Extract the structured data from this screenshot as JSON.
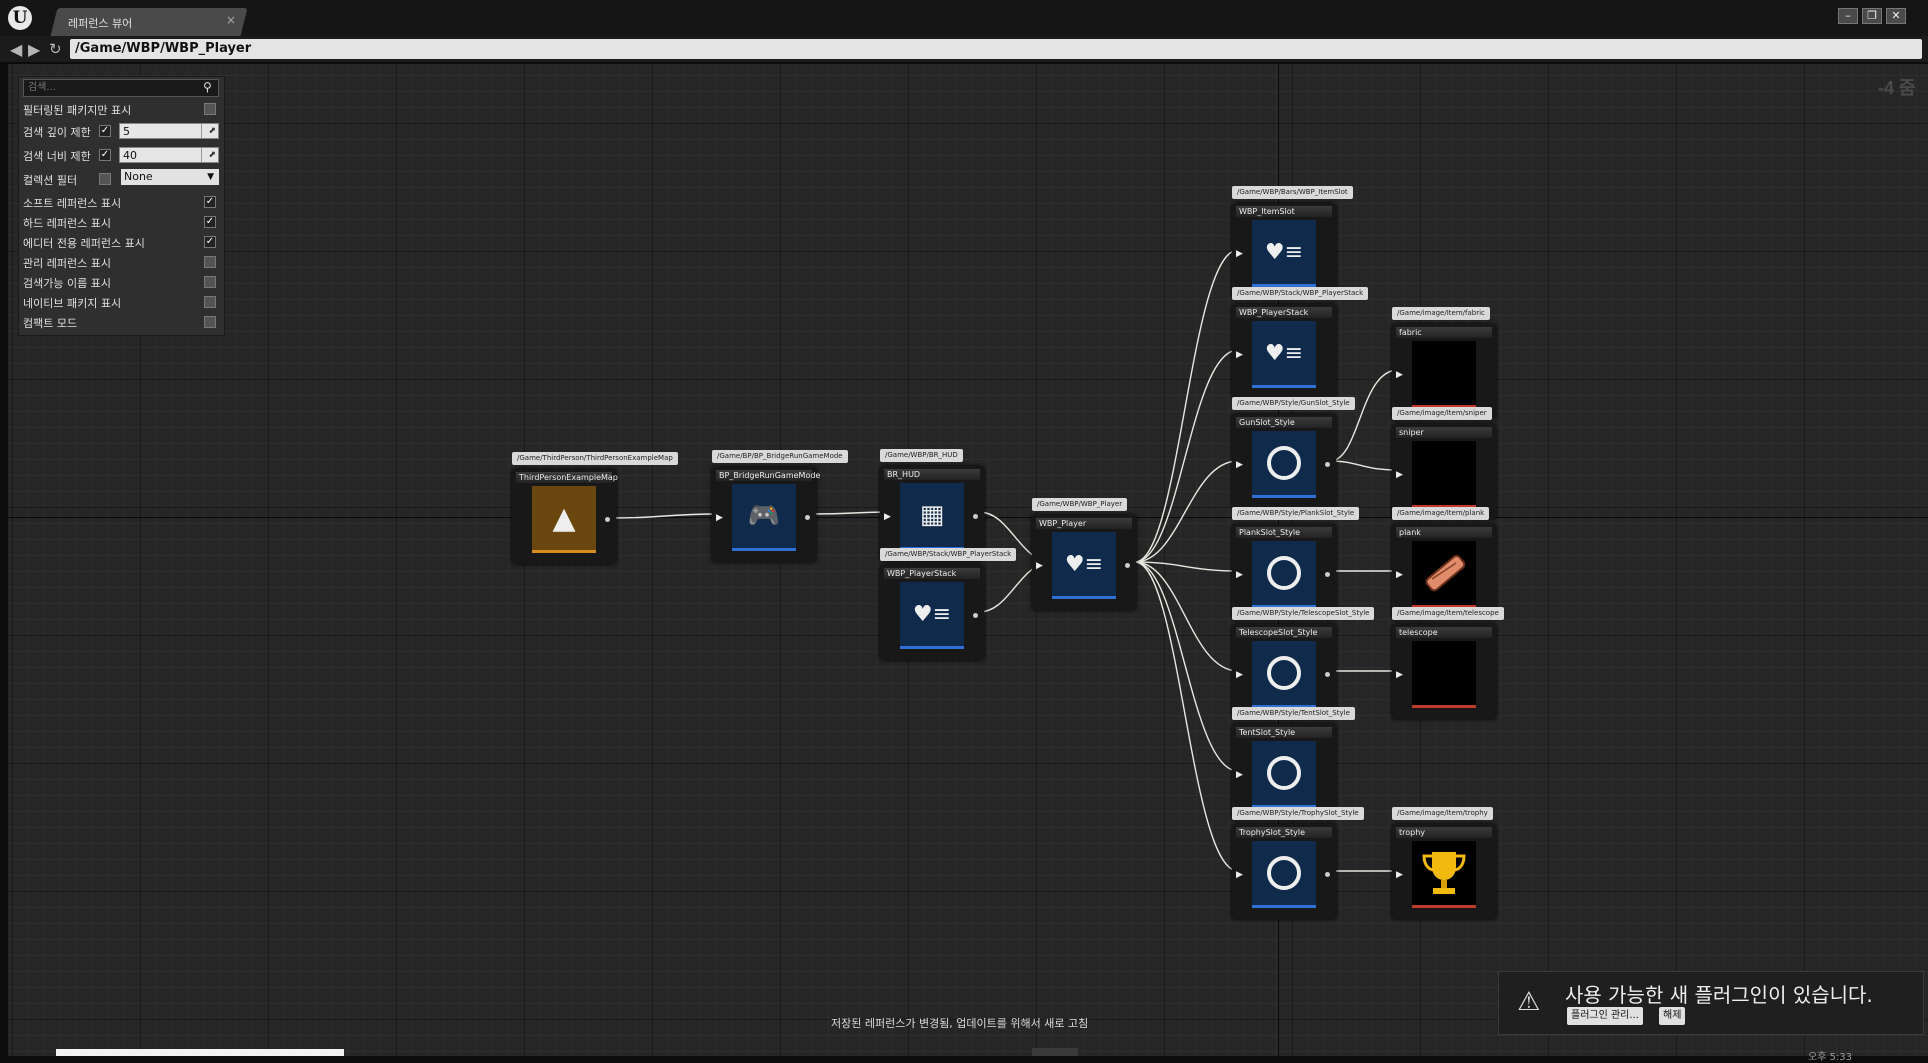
{
  "window": {
    "tab_label": "레퍼런스 뷰어",
    "tab_close": "×",
    "logo": "U",
    "controls": [
      "–",
      "❐",
      "✕"
    ]
  },
  "pathbar": {
    "back_icon": "arrow-left-icon",
    "forward_icon": "arrow-right-icon",
    "refresh_icon": "refresh-icon",
    "path": "/Game/WBP/WBP_Player"
  },
  "zoom": "-4 줌",
  "settings": {
    "search_placeholder": "검색...",
    "filtered_only": {
      "label": "필터링된 패키지만 표시",
      "checked": false
    },
    "depth_limit": {
      "label": "검색 깊이 제한",
      "checked": true,
      "value": "5"
    },
    "breadth_limit": {
      "label": "검색 너비 제한",
      "checked": true,
      "value": "40"
    },
    "collection_filter": {
      "label": "컬렉션 필터",
      "checked": false,
      "value": "None"
    },
    "options": [
      {
        "label": "소프트 레퍼런스 표시",
        "checked": true
      },
      {
        "label": "하드 레퍼런스 표시",
        "checked": true
      },
      {
        "label": "에디터 전용 레퍼런스 표시",
        "checked": true
      },
      {
        "label": "관리 레퍼런스 표시",
        "checked": false
      },
      {
        "label": "검색가능 이름 표시",
        "checked": false
      },
      {
        "label": "네이티브 패키지 표시",
        "checked": false
      },
      {
        "label": "컴팩트 모드",
        "checked": false
      }
    ]
  },
  "nodes": [
    {
      "path": "/Game/ThirdPerson/ThirdPersonExampleMap",
      "name": "ThirdPersonExampleMap",
      "icon": "map-icon",
      "color": "orange"
    },
    {
      "path": "/Game/BP/BP_BridgeRunGameMode",
      "name": "BP_BridgeRunGameMode",
      "icon": "gamepad-icon",
      "color": "blue"
    },
    {
      "path": "/Game/WBP/BR_HUD",
      "name": "BR_HUD",
      "icon": "hud-icon",
      "color": "blue"
    },
    {
      "path": "/Game/WBP/Stack/WBP_PlayerStack",
      "name": "WBP_PlayerStack",
      "icon": "widget-icon",
      "color": "blue"
    },
    {
      "path": "/Game/WBP/WBP_Player",
      "name": "WBP_Player",
      "icon": "widget-icon",
      "color": "blue"
    },
    {
      "path": "/Game/WBP/Bars/WBP_ItemSlot",
      "name": "WBP_ItemSlot",
      "icon": "widget-icon",
      "color": "blue"
    },
    {
      "path": "/Game/WBP/Stack/WBP_PlayerStack",
      "name": "WBP_PlayerStack",
      "icon": "widget-icon",
      "color": "blue"
    },
    {
      "path": "/Game/WBP/Style/GunSlot_Style",
      "name": "GunSlot_Style",
      "icon": "ring-icon",
      "color": "blue"
    },
    {
      "path": "/Game/WBP/Style/PlankSlot_Style",
      "name": "PlankSlot_Style",
      "icon": "ring-icon",
      "color": "blue"
    },
    {
      "path": "/Game/WBP/Style/TelescopeSlot_Style",
      "name": "TelescopeSlot_Style",
      "icon": "ring-icon",
      "color": "blue"
    },
    {
      "path": "/Game/WBP/Style/TentSlot_Style",
      "name": "TentSlot_Style",
      "icon": "ring-icon",
      "color": "blue"
    },
    {
      "path": "/Game/WBP/Style/TrophySlot_Style",
      "name": "TrophySlot_Style",
      "icon": "ring-icon",
      "color": "blue"
    },
    {
      "path": "/Game/image/Item/fabric",
      "name": "fabric",
      "icon": "texture-icon",
      "color": "black"
    },
    {
      "path": "/Game/image/Item/sniper",
      "name": "sniper",
      "icon": "texture-icon",
      "color": "black"
    },
    {
      "path": "/Game/image/Item/plank",
      "name": "plank",
      "icon": "plank-icon",
      "color": "black"
    },
    {
      "path": "/Game/image/Item/telescope",
      "name": "telescope",
      "icon": "texture-icon",
      "color": "black"
    },
    {
      "path": "/Game/image/Item/trophy",
      "name": "trophy",
      "icon": "trophy-icon",
      "color": "black"
    }
  ],
  "status_message": "저장된 레퍼런스가 변경됨, 업데이트를 위해서 새로 고침",
  "notification": {
    "icon": "warning-icon",
    "title": "사용 가능한 새 플러그인이 있습니다.",
    "manage_button": "플러그인 관리...",
    "dismiss_button": "해제"
  },
  "clock": "오후 5:33"
}
